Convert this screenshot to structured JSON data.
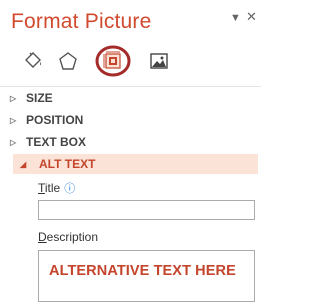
{
  "pane": {
    "title": "Format Picture"
  },
  "tabs": [
    {
      "icon": "fill-line-icon"
    },
    {
      "icon": "effects-icon"
    },
    {
      "icon": "size-properties-icon",
      "selected": true
    },
    {
      "icon": "picture-icon"
    }
  ],
  "sections": [
    {
      "label": "SIZE",
      "expanded": false
    },
    {
      "label": "POSITION",
      "expanded": false
    },
    {
      "label": "TEXT BOX",
      "expanded": false
    },
    {
      "label": "ALT TEXT",
      "expanded": true
    }
  ],
  "alt_text": {
    "title_label_first": "T",
    "title_label_rest": "itle",
    "title_value": "",
    "description_label_first": "D",
    "description_label_rest": "escription",
    "description_value": "ALTERNATIVE TEXT HERE"
  },
  "colors": {
    "accent": "#c4442c",
    "highlight": "#fbe3d8",
    "circle": "#a52a2a"
  }
}
